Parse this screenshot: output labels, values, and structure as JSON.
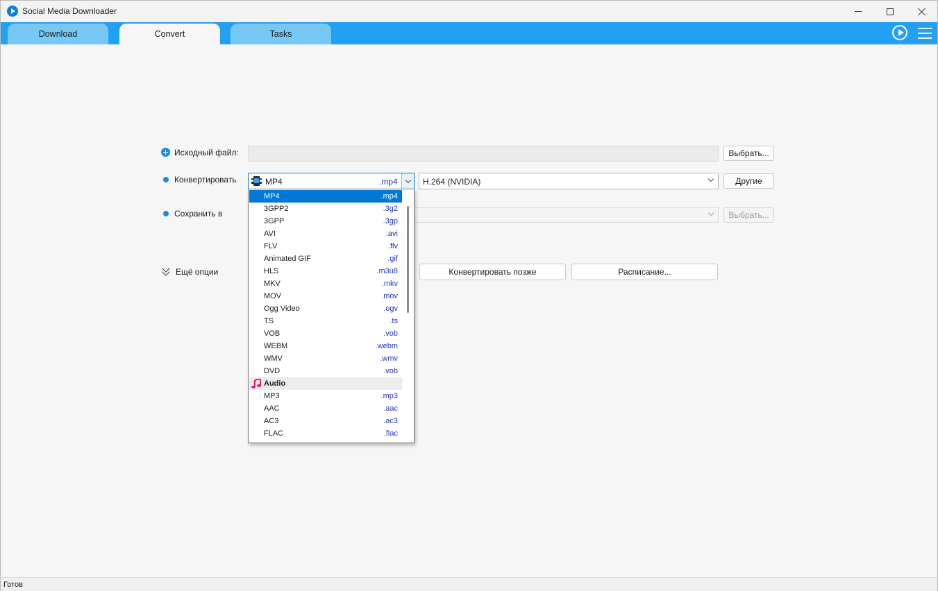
{
  "window": {
    "title": "Social Media Downloader"
  },
  "tabs": [
    {
      "label": "Download"
    },
    {
      "label": "Convert"
    },
    {
      "label": "Tasks"
    }
  ],
  "form": {
    "source_label": "Исходный файл:",
    "source_value": "",
    "source_browse": "Выбрать...",
    "convert_label": "Конвертировать",
    "format_value": "MP4",
    "format_ext": ".mp4",
    "codec_value": "H.264 (NVIDIA)",
    "other_button": "Другие",
    "save_label": "Сохранить в",
    "save_browse": "Выбрать...",
    "more_options": "Ещё опции",
    "convert_later": "Конвертировать позже",
    "schedule": "Расписание..."
  },
  "dropdown": {
    "selected_index": 0,
    "video_items": [
      {
        "name": "MP4",
        "ext": ".mp4"
      },
      {
        "name": "3GPP2",
        "ext": ".3g2"
      },
      {
        "name": "3GPP",
        "ext": ".3gp"
      },
      {
        "name": "AVI",
        "ext": ".avi"
      },
      {
        "name": "FLV",
        "ext": ".flv"
      },
      {
        "name": "Animated GIF",
        "ext": ".gif"
      },
      {
        "name": "HLS",
        "ext": ".m3u8"
      },
      {
        "name": "MKV",
        "ext": ".mkv"
      },
      {
        "name": "MOV",
        "ext": ".mov"
      },
      {
        "name": "Ogg Video",
        "ext": ".ogv"
      },
      {
        "name": "TS",
        "ext": ".ts"
      },
      {
        "name": "VOB",
        "ext": ".vob"
      },
      {
        "name": "WEBM",
        "ext": ".webm"
      },
      {
        "name": "WMV",
        "ext": ".wmv"
      },
      {
        "name": "DVD",
        "ext": ".vob"
      }
    ],
    "audio_group": "Audio",
    "audio_items": [
      {
        "name": "MP3",
        "ext": ".mp3"
      },
      {
        "name": "AAC",
        "ext": ".aac"
      },
      {
        "name": "AC3",
        "ext": ".ac3"
      },
      {
        "name": "FLAC",
        "ext": ".flac"
      }
    ]
  },
  "status": {
    "text": "Готов"
  },
  "colors": {
    "accent": "#21a0f4",
    "selection": "#0078d7",
    "extension": "#1f34c2",
    "audio_icon": "#e0187a"
  }
}
